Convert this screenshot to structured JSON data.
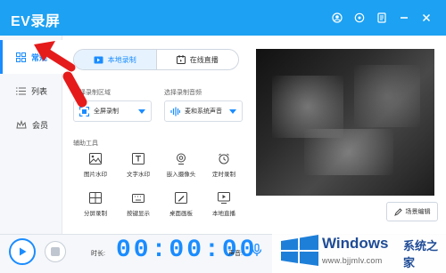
{
  "app": {
    "title": "EV录屏"
  },
  "sidebar": {
    "items": [
      {
        "label": "常规",
        "active": true,
        "icon": "grid-icon"
      },
      {
        "label": "列表",
        "active": false,
        "icon": "list-icon"
      },
      {
        "label": "会员",
        "active": false,
        "icon": "crown-icon"
      }
    ]
  },
  "mode_tabs": [
    {
      "label": "本地录制",
      "active": true,
      "icon": "video-icon"
    },
    {
      "label": "在线直播",
      "active": false,
      "icon": "calendar-icon"
    }
  ],
  "region": {
    "label": "选择录制区域",
    "value": "全屏录制"
  },
  "audio": {
    "label": "选择录制音频",
    "value": "麦和系统声音"
  },
  "tools": {
    "label": "辅助工具",
    "items": [
      "图片水印",
      "文字水印",
      "嵌入摄像头",
      "定时录制",
      "分屏录制",
      "按键显示",
      "桌面画板",
      "本地直播"
    ]
  },
  "scene_button": {
    "label": "场景编辑"
  },
  "bottom": {
    "time_label": "时长:",
    "timer": "00:00:00",
    "volume_label": "声音:"
  },
  "watermark": {
    "brand": "Windows",
    "cn": "系统之家",
    "url": "www.bjjmlv.com"
  },
  "colors": {
    "title_bar": "#1da1f2",
    "accent": "#1a8cff",
    "annotation_arrow": "#e51b1b"
  }
}
